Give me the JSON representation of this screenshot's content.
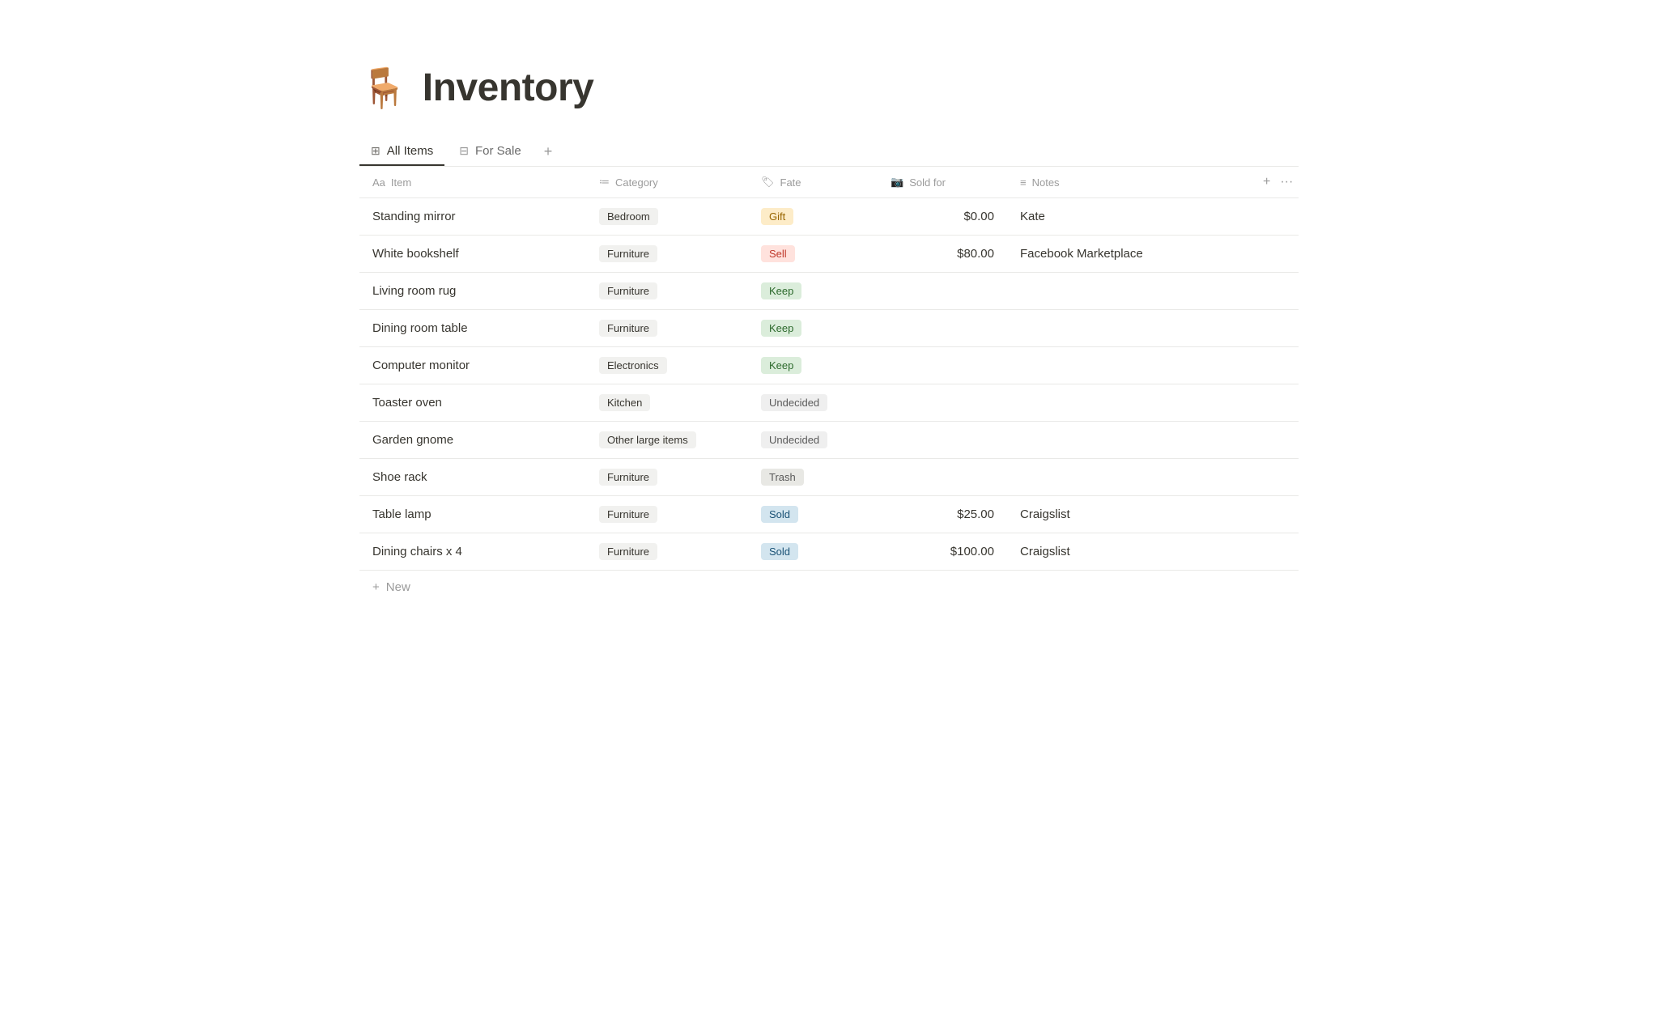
{
  "page": {
    "icon": "🪑",
    "title": "Inventory"
  },
  "tabs": [
    {
      "id": "all-items",
      "label": "All Items",
      "active": true,
      "icon": "⊞"
    },
    {
      "id": "for-sale",
      "label": "For Sale",
      "active": false,
      "icon": "⊟"
    }
  ],
  "tab_add_label": "+",
  "columns": [
    {
      "id": "item",
      "icon": "Aa",
      "label": "Item"
    },
    {
      "id": "category",
      "icon": "≔",
      "label": "Category"
    },
    {
      "id": "fate",
      "icon": "🏷",
      "label": "Fate"
    },
    {
      "id": "sold_for",
      "icon": "📷",
      "label": "Sold for"
    },
    {
      "id": "notes",
      "icon": "≡",
      "label": "Notes"
    }
  ],
  "rows": [
    {
      "item": "Standing mirror",
      "category": "Bedroom",
      "fate": "Gift",
      "fate_type": "gift",
      "sold_for": "$0.00",
      "notes": "Kate"
    },
    {
      "item": "White bookshelf",
      "category": "Furniture",
      "fate": "Sell",
      "fate_type": "sell",
      "sold_for": "$80.00",
      "notes": "Facebook Marketplace"
    },
    {
      "item": "Living room rug",
      "category": "Furniture",
      "fate": "Keep",
      "fate_type": "keep",
      "sold_for": "",
      "notes": ""
    },
    {
      "item": "Dining room table",
      "category": "Furniture",
      "fate": "Keep",
      "fate_type": "keep",
      "sold_for": "",
      "notes": ""
    },
    {
      "item": "Computer monitor",
      "category": "Electronics",
      "fate": "Keep",
      "fate_type": "keep",
      "sold_for": "",
      "notes": ""
    },
    {
      "item": "Toaster oven",
      "category": "Kitchen",
      "fate": "Undecided",
      "fate_type": "undecided",
      "sold_for": "",
      "notes": ""
    },
    {
      "item": "Garden gnome",
      "category": "Other large items",
      "fate": "Undecided",
      "fate_type": "undecided",
      "sold_for": "",
      "notes": ""
    },
    {
      "item": "Shoe rack",
      "category": "Furniture",
      "fate": "Trash",
      "fate_type": "trash",
      "sold_for": "",
      "notes": ""
    },
    {
      "item": "Table lamp",
      "category": "Furniture",
      "fate": "Sold",
      "fate_type": "sold",
      "sold_for": "$25.00",
      "notes": "Craigslist"
    },
    {
      "item": "Dining chairs x 4",
      "category": "Furniture",
      "fate": "Sold",
      "fate_type": "sold",
      "sold_for": "$100.00",
      "notes": "Craigslist"
    }
  ],
  "add_row_label": "New",
  "actions": {
    "add_col": "+",
    "more": "···"
  }
}
